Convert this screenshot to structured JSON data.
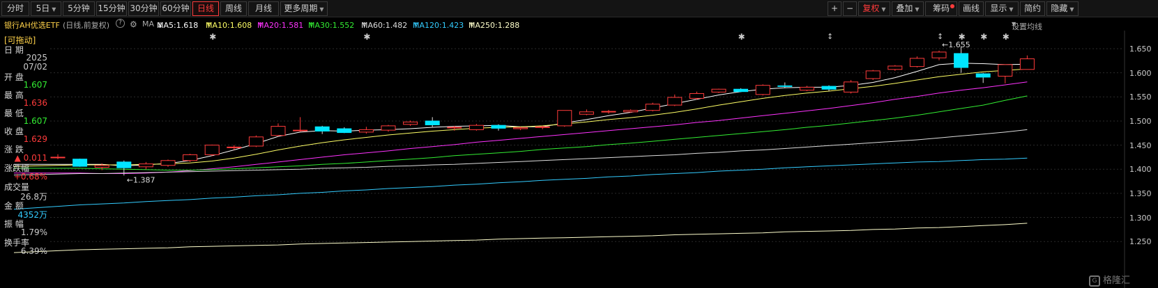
{
  "toolbar": {
    "periods": [
      "分时",
      "5日",
      "5分钟",
      "15分钟",
      "30分钟",
      "60分钟",
      "日线",
      "周线",
      "月线",
      "更多周期"
    ],
    "active_period": "日线",
    "right_buttons": [
      "+",
      "−",
      "复权",
      "叠加",
      "筹码",
      "画线",
      "显示",
      "简约",
      "隐藏"
    ]
  },
  "info": {
    "security_name": "银行AH优选ETF",
    "mode": "(日线,前复权)",
    "help": "?",
    "ma_label": "MA",
    "ma_items": [
      {
        "label": "MA5:1.618",
        "arrow": "↓",
        "color": "#ffffff"
      },
      {
        "label": "MA10:1.608",
        "arrow": "↑",
        "color": "#ffff66"
      },
      {
        "label": "MA20:1.581",
        "arrow": "↑",
        "color": "#ff33ff"
      },
      {
        "label": "MA30:1.552",
        "arrow": "↑",
        "color": "#33ee33"
      },
      {
        "label": "MA60:1.482",
        "arrow": "↑",
        "color": "#dddddd"
      },
      {
        "label": "MA120:1.423",
        "arrow": "↑",
        "color": "#33ccff"
      },
      {
        "label": "MA250:1.288",
        "arrow": "↑",
        "color": "#ffffcc"
      }
    ],
    "settings": "设置均线"
  },
  "side": {
    "tag": "[可拖动]",
    "date_label": "日  期",
    "year": "2025",
    "date": "07/02",
    "open_label": "开  盘",
    "open": "1.607",
    "high_label": "最  高",
    "high": "1.636",
    "low_label": "最  低",
    "low": "1.607",
    "close_label": "收  盘",
    "close": "1.629",
    "change_label": "涨  跌",
    "change": "▲ 0.011",
    "pct_label": "涨跌幅",
    "pct": "+0.68%",
    "volume_label": "成交量",
    "volume": "26.8万",
    "amount_label": "金  额",
    "amount": "4352万",
    "amplitude_label": "振  幅",
    "amplitude": "1.79%",
    "turnover_label": "换手率",
    "turnover": "6.39%"
  },
  "chart_data": {
    "type": "candlestick",
    "ylim": [
      1.22,
      1.67
    ],
    "yticks": [
      "1.650",
      "1.600",
      "1.550",
      "1.500",
      "1.450",
      "1.400",
      "1.350",
      "1.300",
      "1.250"
    ],
    "up_color": "#ff3b3b",
    "down_color": "#00e5ff",
    "annotations": [
      {
        "text": "1.655",
        "candle": 40
      },
      {
        "text": "1.387",
        "candle": 3
      }
    ],
    "markers": {
      "star_candles": [
        7,
        14,
        31,
        41,
        42,
        43
      ],
      "arrow_candles": [
        35,
        40
      ]
    },
    "candles": [
      {
        "o": 1.425,
        "h": 1.431,
        "l": 1.421,
        "c": 1.425
      },
      {
        "o": 1.421,
        "h": 1.422,
        "l": 1.405,
        "c": 1.406
      },
      {
        "o": 1.404,
        "h": 1.412,
        "l": 1.398,
        "c": 1.408
      },
      {
        "o": 1.415,
        "h": 1.418,
        "l": 1.387,
        "c": 1.403
      },
      {
        "o": 1.405,
        "h": 1.415,
        "l": 1.4,
        "c": 1.411
      },
      {
        "o": 1.408,
        "h": 1.42,
        "l": 1.405,
        "c": 1.418
      },
      {
        "o": 1.418,
        "h": 1.432,
        "l": 1.415,
        "c": 1.43
      },
      {
        "o": 1.43,
        "h": 1.451,
        "l": 1.427,
        "c": 1.45
      },
      {
        "o": 1.446,
        "h": 1.45,
        "l": 1.44,
        "c": 1.446
      },
      {
        "o": 1.448,
        "h": 1.47,
        "l": 1.446,
        "c": 1.467
      },
      {
        "o": 1.47,
        "h": 1.495,
        "l": 1.468,
        "c": 1.489
      },
      {
        "o": 1.481,
        "h": 1.508,
        "l": 1.478,
        "c": 1.481
      },
      {
        "o": 1.488,
        "h": 1.49,
        "l": 1.473,
        "c": 1.479
      },
      {
        "o": 1.484,
        "h": 1.487,
        "l": 1.475,
        "c": 1.476
      },
      {
        "o": 1.477,
        "h": 1.488,
        "l": 1.474,
        "c": 1.482
      },
      {
        "o": 1.481,
        "h": 1.492,
        "l": 1.478,
        "c": 1.49
      },
      {
        "o": 1.493,
        "h": 1.501,
        "l": 1.49,
        "c": 1.498
      },
      {
        "o": 1.5,
        "h": 1.508,
        "l": 1.488,
        "c": 1.492
      },
      {
        "o": 1.487,
        "h": 1.49,
        "l": 1.48,
        "c": 1.487
      },
      {
        "o": 1.482,
        "h": 1.494,
        "l": 1.48,
        "c": 1.491
      },
      {
        "o": 1.491,
        "h": 1.493,
        "l": 1.48,
        "c": 1.485
      },
      {
        "o": 1.484,
        "h": 1.488,
        "l": 1.481,
        "c": 1.486
      },
      {
        "o": 1.487,
        "h": 1.49,
        "l": 1.483,
        "c": 1.488
      },
      {
        "o": 1.49,
        "h": 1.522,
        "l": 1.488,
        "c": 1.522
      },
      {
        "o": 1.514,
        "h": 1.524,
        "l": 1.512,
        "c": 1.519
      },
      {
        "o": 1.52,
        "h": 1.523,
        "l": 1.515,
        "c": 1.52
      },
      {
        "o": 1.519,
        "h": 1.524,
        "l": 1.517,
        "c": 1.522
      },
      {
        "o": 1.522,
        "h": 1.538,
        "l": 1.52,
        "c": 1.535
      },
      {
        "o": 1.533,
        "h": 1.555,
        "l": 1.531,
        "c": 1.549
      },
      {
        "o": 1.547,
        "h": 1.561,
        "l": 1.544,
        "c": 1.557
      },
      {
        "o": 1.56,
        "h": 1.567,
        "l": 1.558,
        "c": 1.566
      },
      {
        "o": 1.566,
        "h": 1.568,
        "l": 1.56,
        "c": 1.561
      },
      {
        "o": 1.555,
        "h": 1.576,
        "l": 1.553,
        "c": 1.574
      },
      {
        "o": 1.573,
        "h": 1.58,
        "l": 1.568,
        "c": 1.572
      },
      {
        "o": 1.564,
        "h": 1.573,
        "l": 1.562,
        "c": 1.57
      },
      {
        "o": 1.572,
        "h": 1.574,
        "l": 1.562,
        "c": 1.566
      },
      {
        "o": 1.56,
        "h": 1.585,
        "l": 1.557,
        "c": 1.581
      },
      {
        "o": 1.588,
        "h": 1.606,
        "l": 1.585,
        "c": 1.604
      },
      {
        "o": 1.607,
        "h": 1.616,
        "l": 1.604,
        "c": 1.614
      },
      {
        "o": 1.613,
        "h": 1.634,
        "l": 1.611,
        "c": 1.63
      },
      {
        "o": 1.631,
        "h": 1.646,
        "l": 1.626,
        "c": 1.643
      },
      {
        "o": 1.64,
        "h": 1.655,
        "l": 1.6,
        "c": 1.611
      },
      {
        "o": 1.598,
        "h": 1.6,
        "l": 1.579,
        "c": 1.591
      },
      {
        "o": 1.593,
        "h": 1.612,
        "l": 1.578,
        "c": 1.617
      },
      {
        "o": 1.607,
        "h": 1.636,
        "l": 1.607,
        "c": 1.629
      }
    ],
    "ma_series": [
      {
        "name": "MA5",
        "color": "#ffffff",
        "values": [
          1.41,
          1.41,
          1.41,
          1.407,
          1.409,
          1.412,
          1.418,
          1.428,
          1.44,
          1.453,
          1.468,
          1.477,
          1.48,
          1.479,
          1.481,
          1.482,
          1.484,
          1.487,
          1.489,
          1.49,
          1.491,
          1.488,
          1.488,
          1.496,
          1.503,
          1.511,
          1.518,
          1.527,
          1.536,
          1.545,
          1.554,
          1.561,
          1.566,
          1.569,
          1.57,
          1.57,
          1.574,
          1.58,
          1.59,
          1.603,
          1.617,
          1.62,
          1.619,
          1.617,
          1.618
        ]
      },
      {
        "name": "MA10",
        "color": "#ffff66",
        "values": [
          1.408,
          1.409,
          1.409,
          1.409,
          1.41,
          1.411,
          1.413,
          1.417,
          1.423,
          1.431,
          1.44,
          1.448,
          1.455,
          1.461,
          1.466,
          1.471,
          1.475,
          1.479,
          1.482,
          1.485,
          1.487,
          1.488,
          1.49,
          1.494,
          1.498,
          1.503,
          1.507,
          1.512,
          1.518,
          1.525,
          1.533,
          1.54,
          1.547,
          1.553,
          1.558,
          1.562,
          1.567,
          1.572,
          1.578,
          1.585,
          1.592,
          1.597,
          1.602,
          1.605,
          1.608
        ]
      },
      {
        "name": "MA20",
        "color": "#ff33ff",
        "values": [
          1.392,
          1.392,
          1.391,
          1.391,
          1.392,
          1.394,
          1.397,
          1.401,
          1.405,
          1.41,
          1.415,
          1.42,
          1.425,
          1.43,
          1.434,
          1.438,
          1.443,
          1.447,
          1.451,
          1.456,
          1.46,
          1.464,
          1.468,
          1.472,
          1.476,
          1.48,
          1.484,
          1.488,
          1.492,
          1.497,
          1.501,
          1.506,
          1.511,
          1.516,
          1.521,
          1.526,
          1.532,
          1.538,
          1.545,
          1.551,
          1.558,
          1.564,
          1.569,
          1.575,
          1.581
        ]
      },
      {
        "name": "MA30",
        "color": "#33ee33",
        "values": [
          1.402,
          1.402,
          1.401,
          1.4,
          1.399,
          1.398,
          1.398,
          1.399,
          1.401,
          1.403,
          1.405,
          1.407,
          1.41,
          1.412,
          1.415,
          1.418,
          1.421,
          1.424,
          1.428,
          1.431,
          1.434,
          1.437,
          1.441,
          1.444,
          1.447,
          1.451,
          1.454,
          1.458,
          1.462,
          1.466,
          1.47,
          1.474,
          1.478,
          1.482,
          1.487,
          1.491,
          1.496,
          1.501,
          1.506,
          1.512,
          1.519,
          1.526,
          1.533,
          1.543,
          1.552
        ]
      },
      {
        "name": "MA60",
        "color": "#dddddd",
        "values": [
          1.39,
          1.391,
          1.391,
          1.392,
          1.393,
          1.394,
          1.395,
          1.396,
          1.397,
          1.398,
          1.399,
          1.4,
          1.402,
          1.403,
          1.404,
          1.406,
          1.407,
          1.409,
          1.41,
          1.412,
          1.414,
          1.416,
          1.418,
          1.42,
          1.422,
          1.424,
          1.426,
          1.428,
          1.43,
          1.433,
          1.435,
          1.438,
          1.44,
          1.443,
          1.446,
          1.449,
          1.452,
          1.455,
          1.458,
          1.461,
          1.465,
          1.469,
          1.473,
          1.477,
          1.482
        ]
      },
      {
        "name": "MA120",
        "color": "#33ccff",
        "values": [
          1.323,
          1.326,
          1.328,
          1.33,
          1.333,
          1.335,
          1.337,
          1.34,
          1.342,
          1.345,
          1.347,
          1.35,
          1.352,
          1.355,
          1.357,
          1.36,
          1.362,
          1.364,
          1.367,
          1.369,
          1.372,
          1.374,
          1.377,
          1.379,
          1.381,
          1.384,
          1.386,
          1.389,
          1.391,
          1.393,
          1.396,
          1.398,
          1.4,
          1.403,
          1.405,
          1.407,
          1.409,
          1.411,
          1.413,
          1.415,
          1.416,
          1.418,
          1.42,
          1.421,
          1.423
        ]
      },
      {
        "name": "MA250",
        "color": "#ffffcc",
        "values": [
          1.231,
          1.233,
          1.234,
          1.235,
          1.236,
          1.237,
          1.239,
          1.24,
          1.241,
          1.242,
          1.243,
          1.245,
          1.246,
          1.247,
          1.248,
          1.249,
          1.25,
          1.251,
          1.252,
          1.253,
          1.255,
          1.256,
          1.257,
          1.258,
          1.259,
          1.26,
          1.261,
          1.262,
          1.264,
          1.265,
          1.266,
          1.267,
          1.268,
          1.27,
          1.271,
          1.272,
          1.273,
          1.275,
          1.276,
          1.278,
          1.279,
          1.281,
          1.283,
          1.285,
          1.288
        ]
      }
    ]
  },
  "watermark": "格隆汇"
}
